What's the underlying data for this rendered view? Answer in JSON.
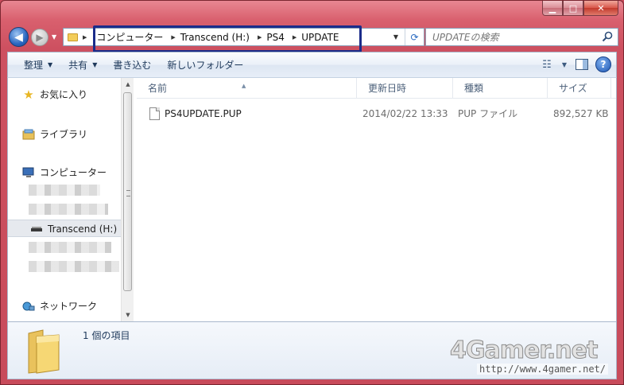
{
  "window": {
    "caption_buttons": {
      "minimize": "▁",
      "maximize": "□",
      "close": "✕"
    }
  },
  "nav": {
    "back_glyph": "◀",
    "forward_glyph": "▶",
    "breadcrumbs": [
      "コンピューター",
      "Transcend (H:)",
      "PS4",
      "UPDATE"
    ]
  },
  "search": {
    "placeholder": "UPDATEの検索"
  },
  "toolbar": {
    "organize": "整理",
    "share": "共有",
    "burn": "書き込む",
    "new_folder": "新しいフォルダー",
    "help": "?"
  },
  "nav_pane": {
    "favorites": "お気に入り",
    "libraries": "ライブラリ",
    "computer": "コンピューター",
    "drive": "Transcend (H:)",
    "network": "ネットワーク"
  },
  "columns": {
    "name": "名前",
    "date": "更新日時",
    "type": "種類",
    "size": "サイズ"
  },
  "files": [
    {
      "name": "PS4UPDATE.PUP",
      "date": "2014/02/22 13:33",
      "type": "PUP ファイル",
      "size": "892,527 KB"
    }
  ],
  "details": {
    "item_count": "1 個の項目"
  },
  "watermark": {
    "logo": "4Gamer.net",
    "url": "http://www.4gamer.net/"
  },
  "colors": {
    "titlebar": "#d9606e",
    "highlight_box": "#1b2c8a",
    "accent": "#2a66c0"
  }
}
